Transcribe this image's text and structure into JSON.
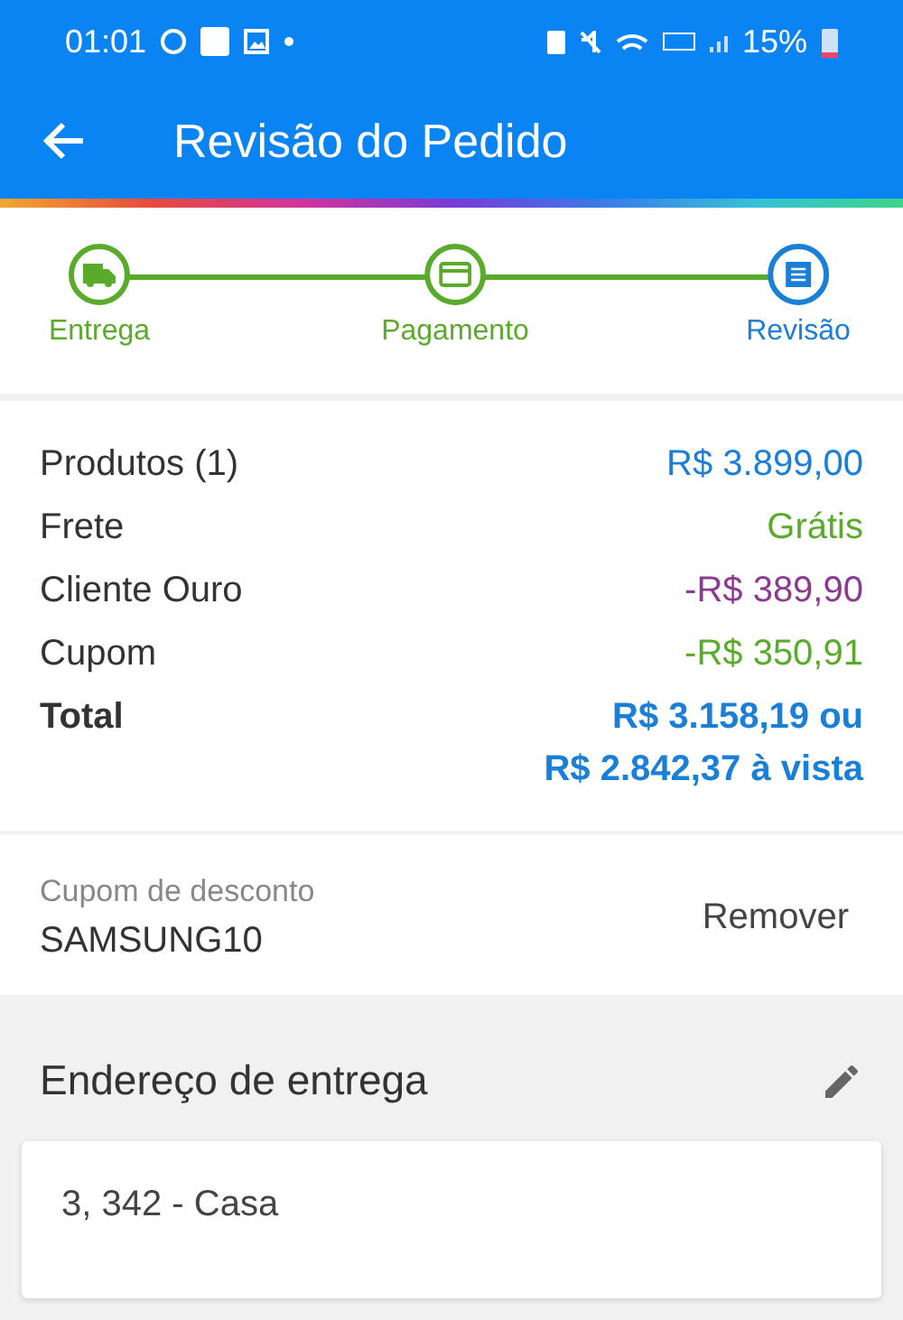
{
  "status_bar": {
    "time": "01:01",
    "battery": "15%"
  },
  "app_bar": {
    "title": "Revisão do Pedido"
  },
  "steps": [
    {
      "label": "Entrega",
      "kind": "truck",
      "selected": false
    },
    {
      "label": "Pagamento",
      "kind": "card",
      "selected": false
    },
    {
      "label": "Revisão",
      "kind": "list",
      "selected": true
    }
  ],
  "summary": [
    {
      "label": "Produtos (1)",
      "value": "R$ 3.899,00",
      "color": "#1a7fd6"
    },
    {
      "label": "Frete",
      "value": "Grátis",
      "color": "#5aab2b"
    },
    {
      "label": "Cliente Ouro",
      "value": "-R$ 389,90",
      "color": "#8b3a8f"
    },
    {
      "label": "Cupom",
      "value": "-R$ 350,91",
      "color": "#5aab2b"
    }
  ],
  "total": {
    "label": "Total",
    "lines": [
      "R$ 3.158,19 ou",
      "R$ 2.842,37 à vista"
    ]
  },
  "coupon": {
    "label": "Cupom de desconto",
    "code": "SAMSUNG10",
    "action": "Remover"
  },
  "address": {
    "title": "Endereço de entrega",
    "line": "3, 342 - Casa"
  }
}
